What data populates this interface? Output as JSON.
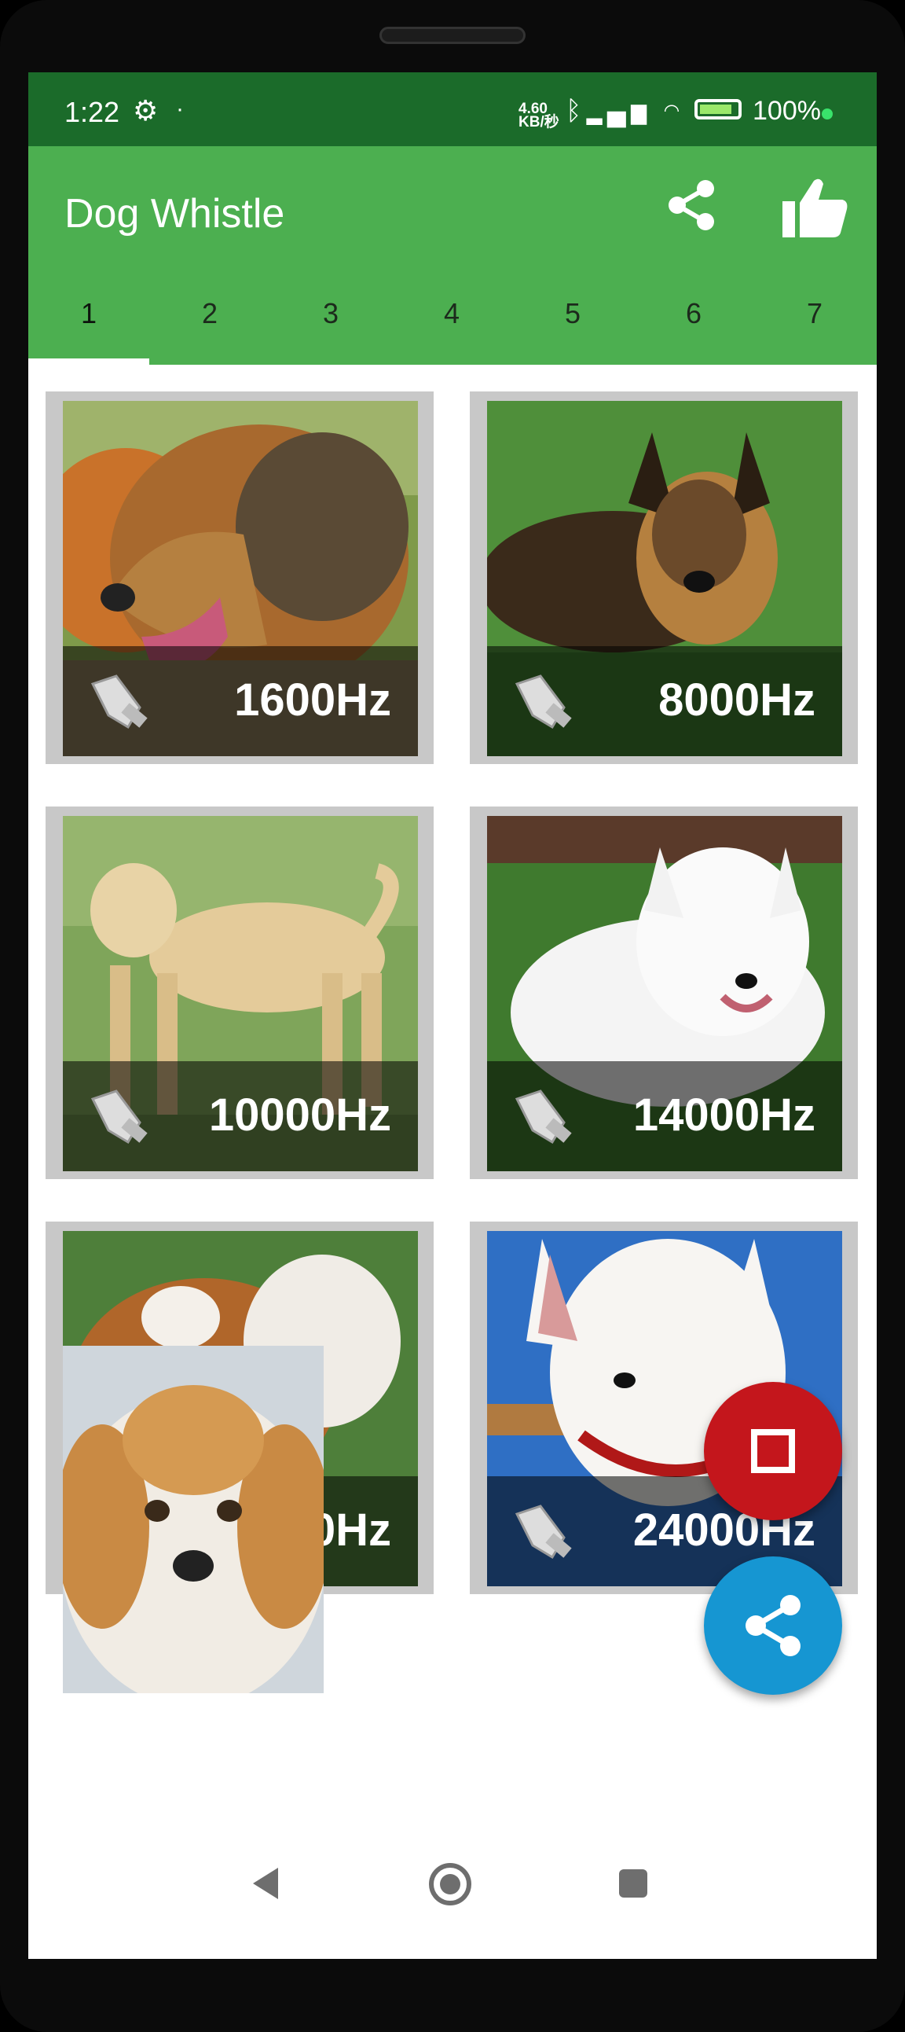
{
  "statusbar": {
    "time": "1:22",
    "network_speed": "4.60\nKB/秒",
    "battery": "100%"
  },
  "appbar": {
    "title": "Dog Whistle"
  },
  "tabs": [
    {
      "label": "1"
    },
    {
      "label": "2"
    },
    {
      "label": "3"
    },
    {
      "label": "4"
    },
    {
      "label": "5"
    },
    {
      "label": "6"
    },
    {
      "label": "7"
    }
  ],
  "cards": [
    {
      "freq": "1600Hz"
    },
    {
      "freq": "8000Hz"
    },
    {
      "freq": "10000Hz"
    },
    {
      "freq": "14000Hz"
    },
    {
      "freq": "0Hz"
    },
    {
      "freq": "24000Hz"
    }
  ],
  "colors": {
    "primary": "#4caf50",
    "status": "#1b6b2a",
    "stop": "#c4161c",
    "share": "#1696d2"
  }
}
